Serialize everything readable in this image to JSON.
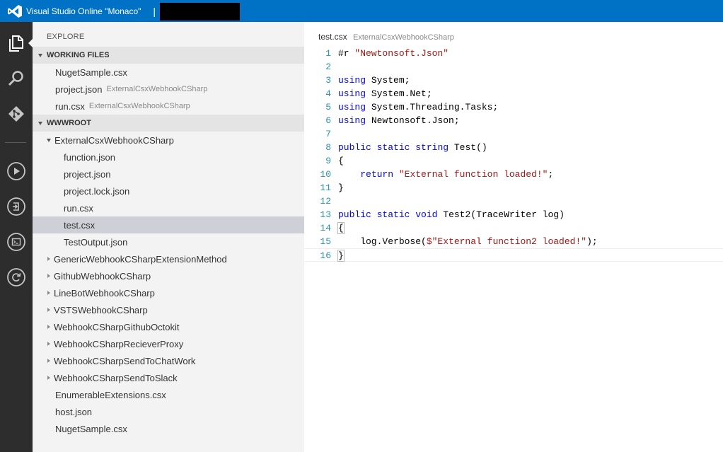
{
  "titlebar": {
    "app_title": "Visual Studio Online \"Monaco\"",
    "separator": "|"
  },
  "activity_bar": {
    "icons": [
      "files-icon",
      "search-icon",
      "git-icon",
      "run-icon",
      "deploy-icon",
      "console-icon",
      "refresh-icon"
    ]
  },
  "sidebar": {
    "title": "EXPLORE",
    "working_files": {
      "header": "WORKING FILES",
      "items": [
        {
          "name": "NugetSample.csx",
          "hint": ""
        },
        {
          "name": "project.json",
          "hint": "ExternalCsxWebhookCSharp"
        },
        {
          "name": "run.csx",
          "hint": "ExternalCsxWebhookCSharp"
        }
      ]
    },
    "wwwroot": {
      "header": "WWWROOT",
      "expanded_folder": "ExternalCsxWebhookCSharp",
      "folder_files": [
        "function.json",
        "project.json",
        "project.lock.json",
        "run.csx",
        "test.csx",
        "TestOutput.json"
      ],
      "selected_file": "test.csx",
      "collapsed_folders": [
        "GenericWebhookCSharpExtensionMethod",
        "GithubWebhookCSharp",
        "LineBotWebhookCSharp",
        "VSTSWebhookCSharp",
        "WebhookCSharpGithubOctokit",
        "WebhookCSharpRecieverProxy",
        "WebhookCSharpSendToChatWork",
        "WebhookCSharpSendToSlack"
      ],
      "root_files": [
        "EnumerableExtensions.csx",
        "host.json",
        "NugetSample.csx"
      ]
    }
  },
  "editor": {
    "file_name": "test.csx",
    "folder_name": "ExternalCsxWebhookCSharp",
    "lines": [
      "#r \"Newtonsoft.Json\"",
      "",
      "using System;",
      "using System.Net;",
      "using System.Threading.Tasks;",
      "using Newtonsoft.Json;",
      "",
      "public static string Test()",
      "{",
      "    return \"External function loaded!\";",
      "}",
      "",
      "public static void Test2(TraceWriter log)",
      "{",
      "    log.Verbose($\"External function2 loaded!\");",
      "}"
    ],
    "current_line": 16
  },
  "colors": {
    "titlebar": "#0072c6",
    "activity_bar": "#2d2d2d",
    "sidebar": "#f3f3f3",
    "keyword": "#0000ff",
    "string": "#a31515",
    "line_number": "#2b91af"
  }
}
